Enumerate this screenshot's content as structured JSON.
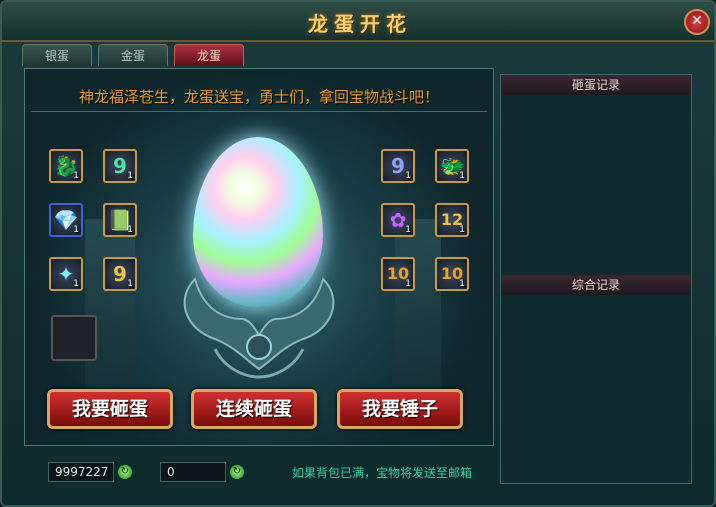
{
  "window": {
    "title": "龙蛋开花",
    "close_icon": "close-icon"
  },
  "tabs": [
    {
      "label": "银蛋",
      "active": false
    },
    {
      "label": "金蛋",
      "active": false
    },
    {
      "label": "龙蛋",
      "active": true
    }
  ],
  "main": {
    "slogan": "神龙福泽苍生，龙蛋送宝，勇士们，拿回宝物战斗吧！",
    "items": [
      {
        "icon": "dragon-mount-icon",
        "glyph": "🐉",
        "count": "1"
      },
      {
        "icon": "number-9-icon",
        "glyph": "9",
        "count": "1"
      },
      {
        "icon": "crystal-icon",
        "glyph": "💎",
        "count": "1"
      },
      {
        "icon": "book-icon",
        "glyph": "📗",
        "count": "1"
      },
      {
        "icon": "gem-icon",
        "glyph": "✦",
        "count": "1"
      },
      {
        "icon": "number-9-icon",
        "glyph": "9",
        "count": "1"
      },
      {
        "icon": "number-9-icon",
        "glyph": "9",
        "count": "1"
      },
      {
        "icon": "dragon-mount-icon",
        "glyph": "🐲",
        "count": "1"
      },
      {
        "icon": "flower-icon",
        "glyph": "✿",
        "count": "1"
      },
      {
        "icon": "number-12-icon",
        "glyph": "12",
        "count": "1"
      },
      {
        "icon": "number-10-icon",
        "glyph": "10",
        "count": "1"
      },
      {
        "icon": "number-10-icon",
        "glyph": "10",
        "count": "1"
      }
    ],
    "buttons": {
      "smash": "我要砸蛋",
      "smash_continuous": "连续砸蛋",
      "get_hammer": "我要锤子"
    }
  },
  "sidebar": {
    "smash_log_title": "砸蛋记录",
    "general_log_title": "综合记录"
  },
  "footer": {
    "gold": "9997227",
    "hammers": "0",
    "notice": "如果背包已满，宝物将发送至邮箱"
  },
  "colors": {
    "accent": "#f0a030",
    "button_red": "#c02020",
    "notice": "#40d0a0"
  }
}
